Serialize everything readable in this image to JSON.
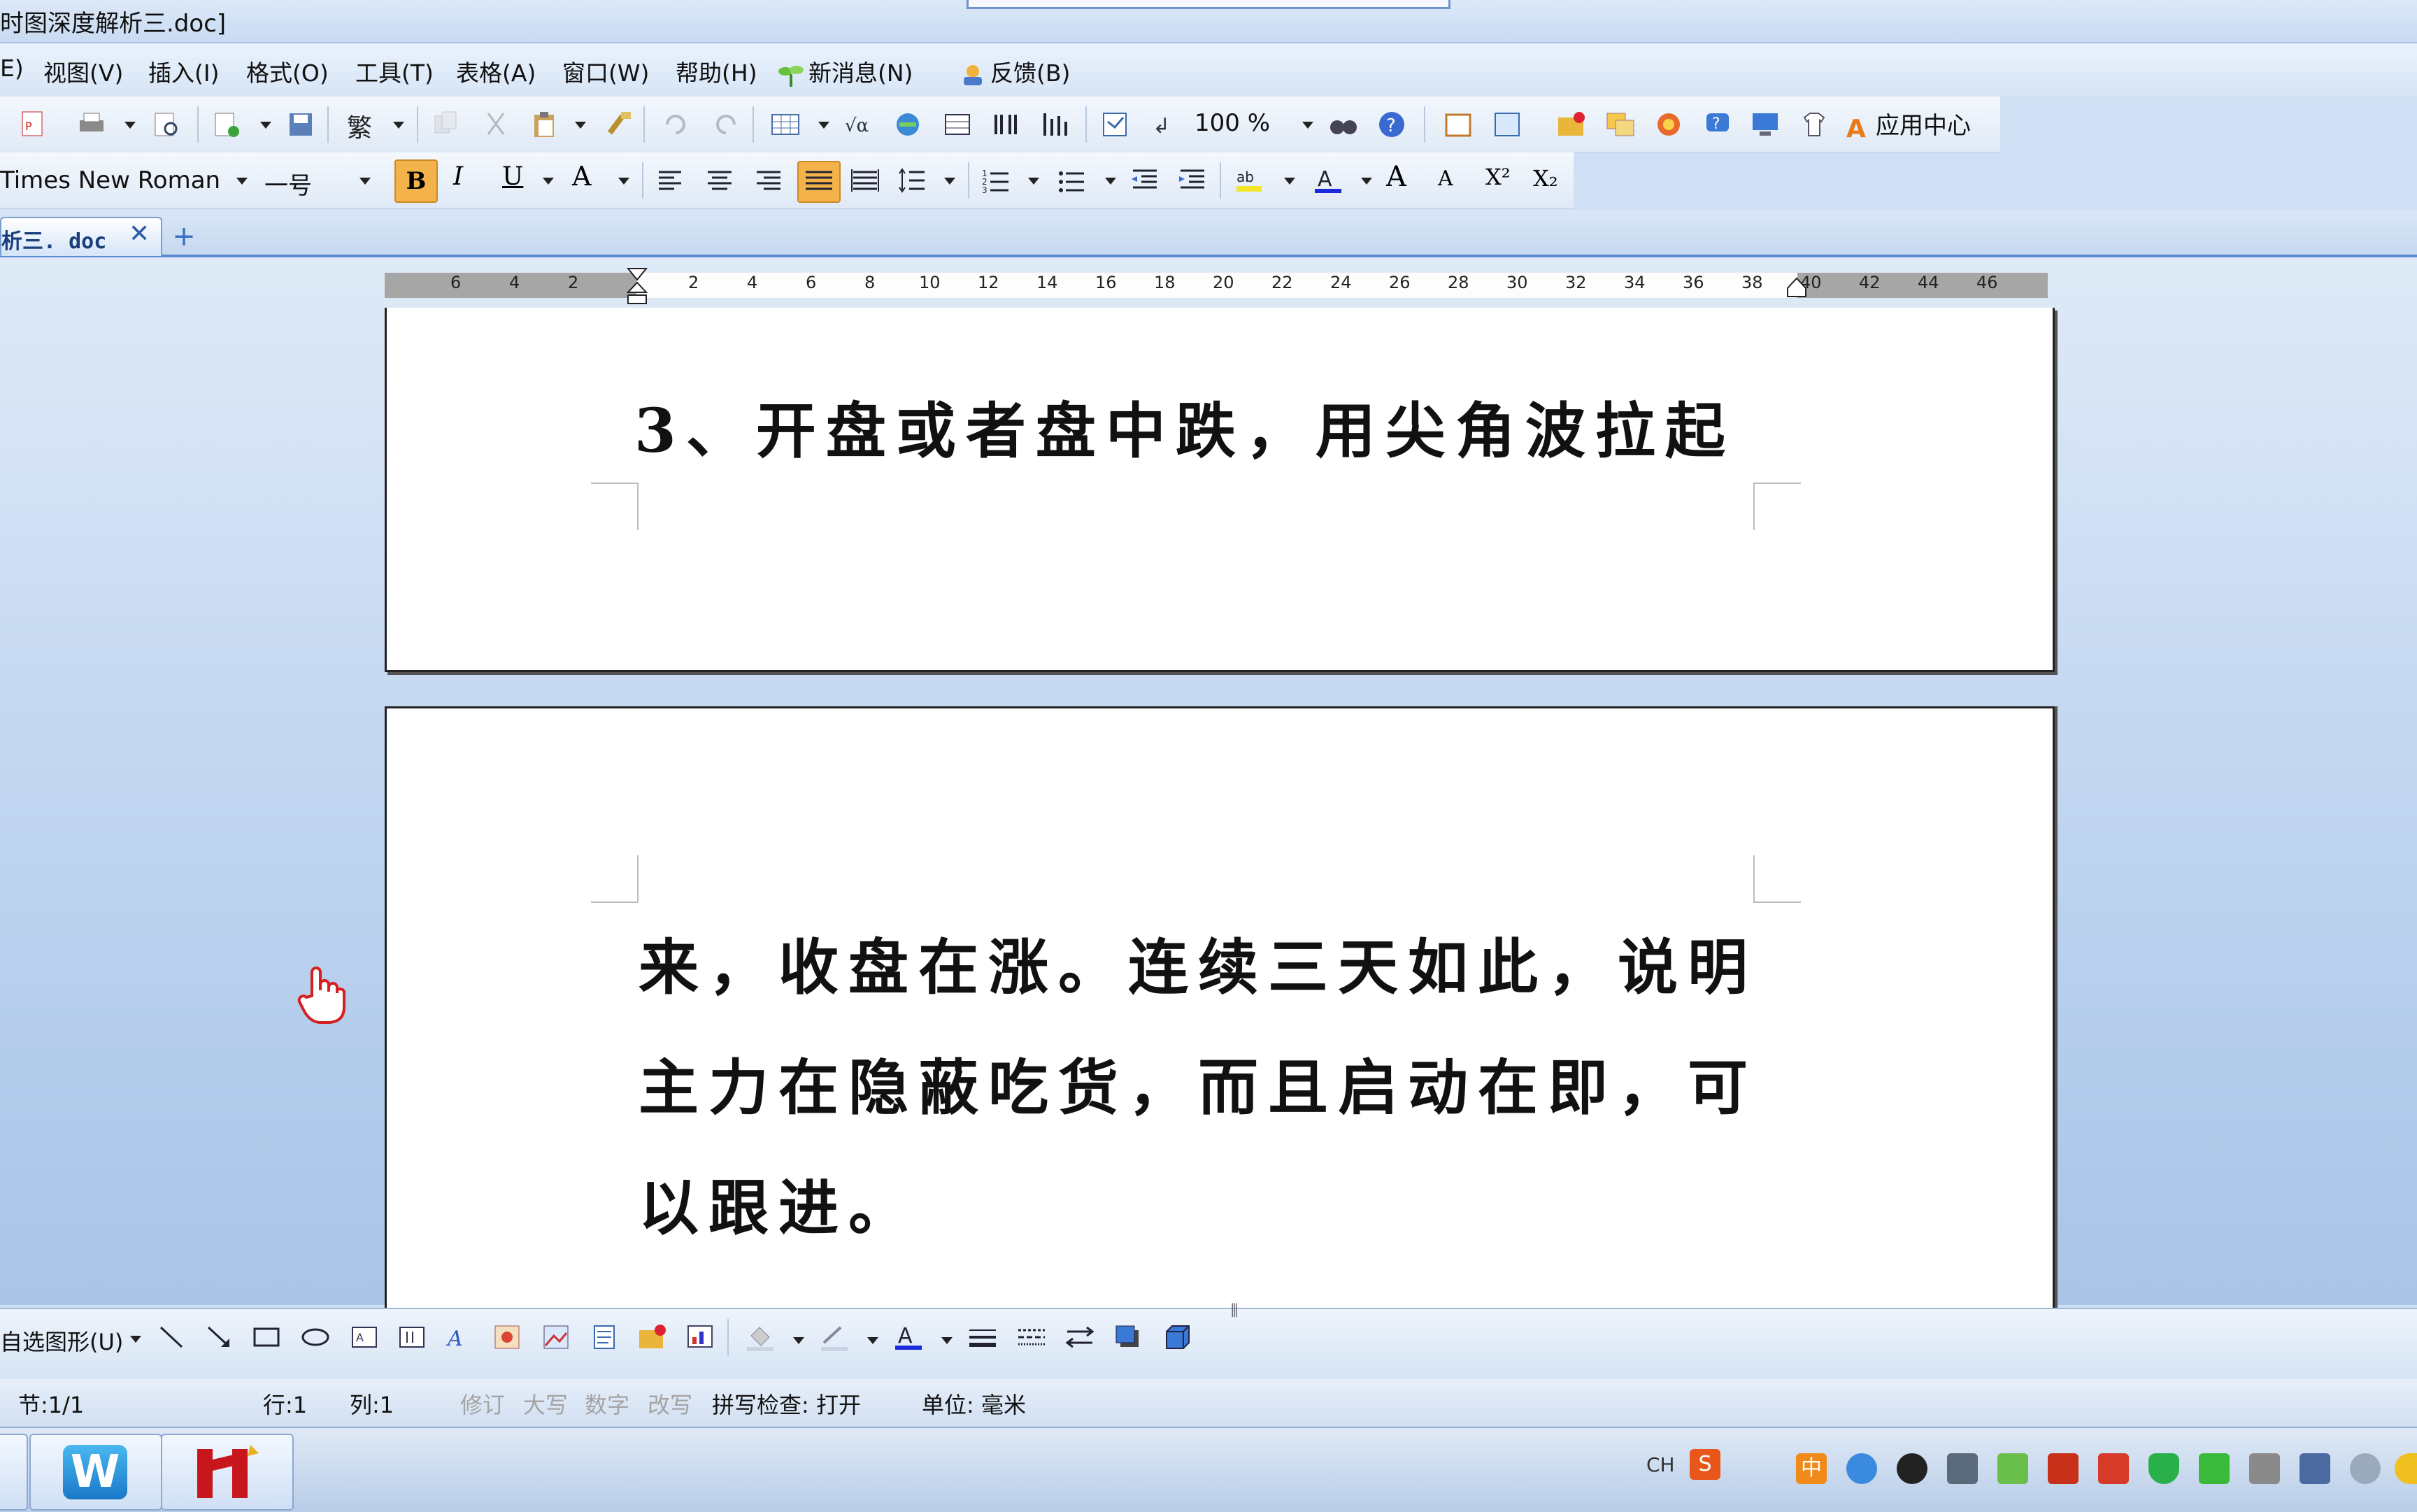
{
  "window": {
    "title": "时图深度解析三.doc]"
  },
  "menubar": {
    "items": [
      {
        "label": "E)"
      },
      {
        "label": "视图(V)"
      },
      {
        "label": "插入(I)"
      },
      {
        "label": "格式(O)"
      },
      {
        "label": "工具(T)"
      },
      {
        "label": "表格(A)"
      },
      {
        "label": "窗口(W)"
      },
      {
        "label": "帮助(H)"
      },
      {
        "label": "新消息(N)"
      },
      {
        "label": "反馈(B)"
      }
    ]
  },
  "toolbar": {
    "zoom": "100 %",
    "traditional_label": "繁",
    "app_center_label": "应用中心"
  },
  "format_bar": {
    "font_name": "Times New Roman",
    "font_size": "一号",
    "bold_label": "B",
    "italic_label": "I",
    "underline_label": "U",
    "grow_label": "A",
    "shrink_label": "A",
    "superscript_label": "X²",
    "subscript_label": "X₂"
  },
  "tabs": {
    "active_label": "析三. doc",
    "close_glyph": "✕",
    "new_glyph": "+"
  },
  "ruler": {
    "left_numbers": [
      "6",
      "4",
      "2"
    ],
    "right_numbers": [
      "2",
      "4",
      "6",
      "8",
      "10",
      "12",
      "14",
      "16",
      "18",
      "20",
      "22",
      "24",
      "26",
      "28",
      "30",
      "32",
      "34",
      "36",
      "38",
      "40",
      "42",
      "44",
      "46"
    ]
  },
  "document": {
    "page1_line": "3、开盘或者盘中跌，用尖角波拉起",
    "page2_lines": [
      "来，收盘在涨。连续三天如此，说明",
      "主力在隐蔽吃货，而且启动在即，可",
      "以跟进。"
    ]
  },
  "drawing_bar": {
    "autoshapes_label": "自选图形(U)"
  },
  "statusbar": {
    "section": "节:1/1",
    "row": "行:1",
    "column": "列:1",
    "track_changes": "修订",
    "caps": "大写",
    "num": "数字",
    "overwrite": "改写",
    "spellcheck": "拼写检查: 打开",
    "unit": "单位: 毫米"
  },
  "taskbar": {
    "wps_label": "W",
    "ime_label": "CH",
    "ime_s_label": "S",
    "cn_label": "中"
  },
  "colors": {
    "accent": "#5a8bd0",
    "bold_active": "#f4b24a",
    "justify_active": "#f4b24a"
  }
}
